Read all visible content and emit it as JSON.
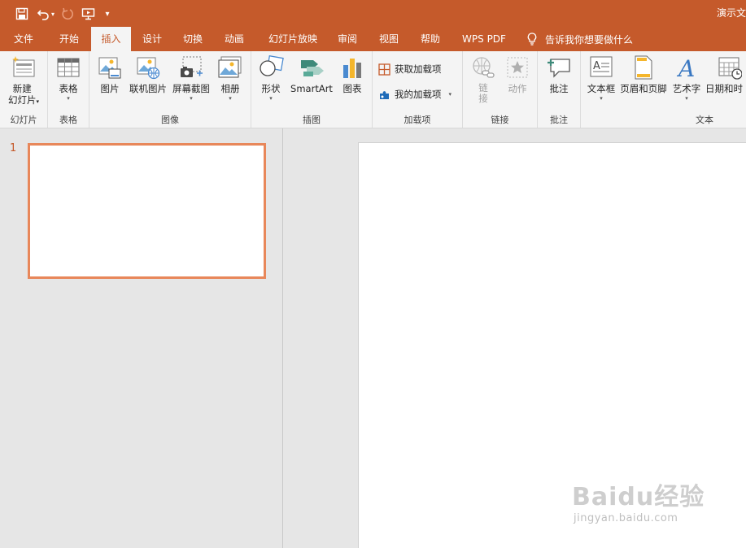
{
  "titlebar": {
    "document_title": "演示文",
    "quick_access": [
      "save-icon",
      "undo-icon",
      "redo-icon",
      "start-from-beginning-icon",
      "customize-qat-icon"
    ]
  },
  "tabs": [
    {
      "label": "文件",
      "active": false
    },
    {
      "label": "开始",
      "active": false
    },
    {
      "label": "插入",
      "active": true
    },
    {
      "label": "设计",
      "active": false
    },
    {
      "label": "切换",
      "active": false
    },
    {
      "label": "动画",
      "active": false
    },
    {
      "label": "幻灯片放映",
      "active": false
    },
    {
      "label": "审阅",
      "active": false
    },
    {
      "label": "视图",
      "active": false
    },
    {
      "label": "帮助",
      "active": false
    },
    {
      "label": "WPS PDF",
      "active": false
    }
  ],
  "tell_me": {
    "label": "告诉我你想要做什么",
    "icon": "lightbulb-icon"
  },
  "ribbon": {
    "slides_group": {
      "label": "幻灯片",
      "new_slide": "新建\n幻灯片"
    },
    "tables_group": {
      "label": "表格",
      "table": "表格"
    },
    "images_group": {
      "label": "图像",
      "picture": "图片",
      "online_picture": "联机图片",
      "screenshot": "屏幕截图",
      "album": "相册"
    },
    "illustrations_group": {
      "label": "插图",
      "shapes": "形状",
      "smartart": "SmartArt",
      "chart": "图表"
    },
    "addins_group": {
      "label": "加载项",
      "get_addins": "获取加载项",
      "my_addins": "我的加载项"
    },
    "links_group": {
      "label": "链接",
      "link": "链\n接",
      "action": "动作"
    },
    "comments_group": {
      "label": "批注",
      "comment": "批注"
    },
    "text_group": {
      "label": "文本",
      "textbox": "文本框",
      "header_footer": "页眉和页脚",
      "wordart": "艺术字",
      "datetime": "日期和时"
    }
  },
  "thumbnails": {
    "slide_number": "1"
  },
  "colors": {
    "accent": "#c55a2b",
    "selection": "#e8875a"
  },
  "watermark": {
    "brand": "Baidu经验",
    "url": "jingyan.baidu.com"
  }
}
